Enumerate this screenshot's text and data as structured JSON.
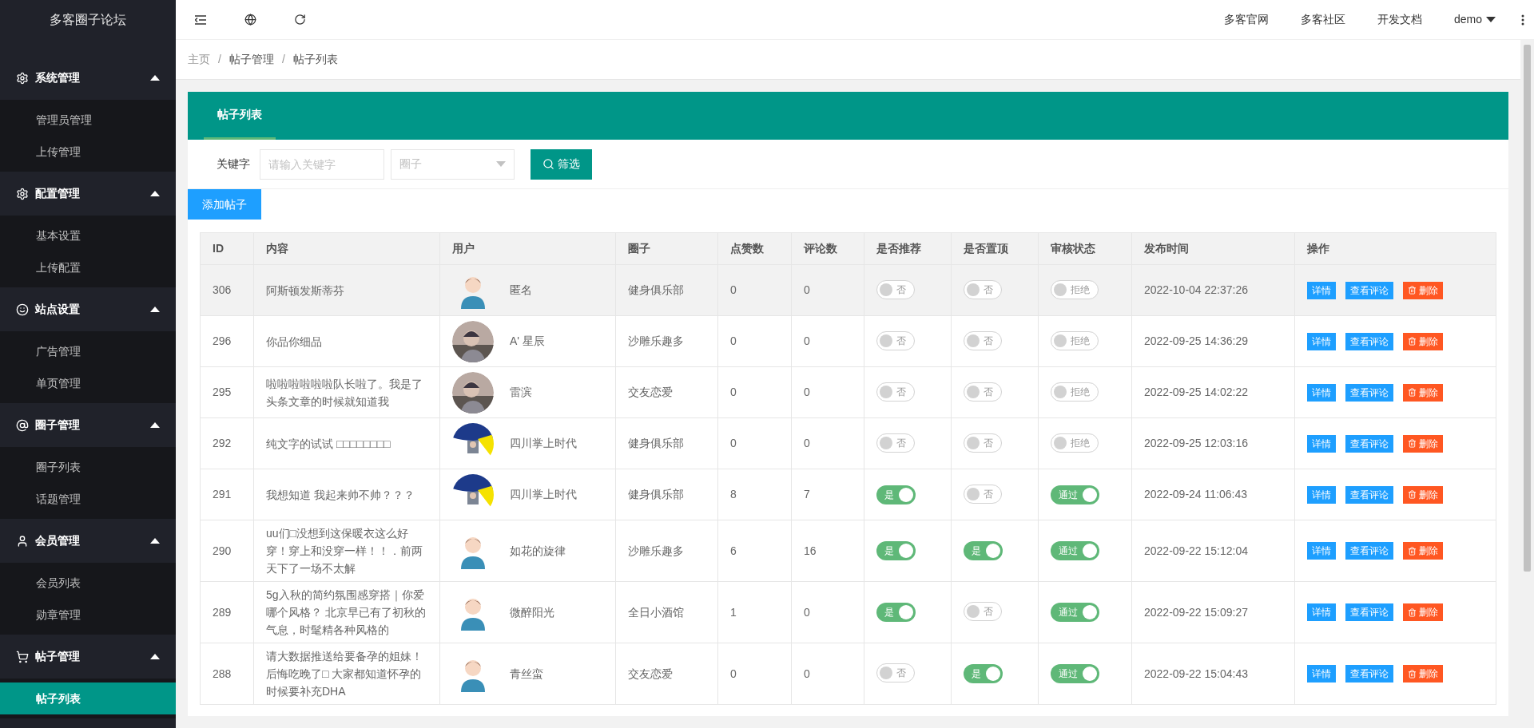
{
  "sidebar": {
    "title": "多客圈子论坛",
    "groups": [
      {
        "label": "系统管理",
        "expanded": true,
        "items": [
          {
            "label": "管理员管理",
            "selected": false
          },
          {
            "label": "上传管理",
            "selected": false
          }
        ]
      },
      {
        "label": "配置管理",
        "expanded": true,
        "items": [
          {
            "label": "基本设置",
            "selected": false
          },
          {
            "label": "上传配置",
            "selected": false
          }
        ]
      },
      {
        "label": "站点设置",
        "expanded": true,
        "items": [
          {
            "label": "广告管理",
            "selected": false
          },
          {
            "label": "单页管理",
            "selected": false
          }
        ]
      },
      {
        "label": "圈子管理",
        "expanded": true,
        "items": [
          {
            "label": "圈子列表",
            "selected": false
          },
          {
            "label": "话题管理",
            "selected": false
          }
        ]
      },
      {
        "label": "会员管理",
        "expanded": true,
        "items": [
          {
            "label": "会员列表",
            "selected": false
          },
          {
            "label": "勋章管理",
            "selected": false
          }
        ]
      },
      {
        "label": "帖子管理",
        "expanded": true,
        "items": [
          {
            "label": "帖子列表",
            "selected": true
          }
        ]
      }
    ]
  },
  "topbar": {
    "links": [
      "多客官网",
      "多客社区",
      "开发文档"
    ],
    "user": "demo"
  },
  "breadcrumb": {
    "separator": "/",
    "items": [
      "主页",
      "帖子管理",
      "帖子列表"
    ]
  },
  "card": {
    "tab": "帖子列表"
  },
  "filter": {
    "label": "关键字",
    "keyword_placeholder": "请输入关键字",
    "circle_placeholder": "圈子",
    "button": "筛选"
  },
  "add_button": "添加帖子",
  "table": {
    "columns": [
      "ID",
      "内容",
      "用户",
      "圈子",
      "点赞数",
      "评论数",
      "是否推荐",
      "是否置顶",
      "审核状态",
      "发布时间",
      "操作"
    ],
    "rows": [
      {
        "highlighted": true,
        "id": "306",
        "content": "阿斯顿发斯蒂芬",
        "avatar": {
          "kind": "default"
        },
        "user": "匿名",
        "circle": "健身俱乐部",
        "likes": "0",
        "comments": "0",
        "recommend": {
          "on": false,
          "label": "否"
        },
        "pinned": {
          "on": false,
          "label": "否"
        },
        "audit": {
          "on": false,
          "label": "拒绝"
        },
        "time": "2022-10-04 22:37:26",
        "actions": [
          "详情",
          "查看评论",
          "删除"
        ]
      },
      {
        "highlighted": false,
        "id": "296",
        "content": "你品你细品",
        "user": "A' 星辰",
        "circle": "沙雕乐趣多",
        "likes": "0",
        "comments": "0",
        "recommend": {
          "on": false,
          "label": "否"
        },
        "pinned": {
          "on": false,
          "label": "否"
        },
        "audit": {
          "on": false,
          "label": "拒绝"
        },
        "time": "2022-09-25 14:36:29",
        "actions": [
          "详情",
          "查看评论",
          "删除"
        ]
      },
      {
        "highlighted": false,
        "id": "295",
        "content": "啦啦啦啦啦啦队长啦了。我是了头条文章的时候就知道我",
        "user": "雷滨",
        "circle": "交友恋爱",
        "likes": "0",
        "comments": "0",
        "recommend": {
          "on": false,
          "label": "否"
        },
        "pinned": {
          "on": false,
          "label": "否"
        },
        "audit": {
          "on": false,
          "label": "拒绝"
        },
        "time": "2022-09-25 14:02:22",
        "actions": [
          "详情",
          "查看评论",
          "删除"
        ]
      },
      {
        "highlighted": false,
        "id": "292",
        "content": "纯文字的试试 □□□□□□□□",
        "user": "四川掌上时代",
        "circle": "健身俱乐部",
        "likes": "0",
        "comments": "0",
        "recommend": {
          "on": false,
          "label": "否"
        },
        "pinned": {
          "on": false,
          "label": "否"
        },
        "audit": {
          "on": false,
          "label": "拒绝"
        },
        "time": "2022-09-25 12:03:16",
        "actions": [
          "详情",
          "查看评论",
          "删除"
        ]
      },
      {
        "highlighted": false,
        "id": "291",
        "content": "我想知道 我起来帅不帅？？？",
        "user": "四川掌上时代",
        "circle": "健身俱乐部",
        "likes": "8",
        "comments": "7",
        "recommend": {
          "on": true,
          "label": "是"
        },
        "pinned": {
          "on": false,
          "label": "否"
        },
        "audit": {
          "on": true,
          "label": "通过"
        },
        "time": "2022-09-24 11:06:43",
        "actions": [
          "详情",
          "查看评论",
          "删除"
        ]
      },
      {
        "highlighted": false,
        "id": "290",
        "content": "uu们□没想到这保暖衣这么好穿！穿上和没穿一样！！．前两天下了一场不太解",
        "avatar": {
          "kind": "default"
        },
        "user": "如花的旋律",
        "circle": "沙雕乐趣多",
        "likes": "6",
        "comments": "16",
        "recommend": {
          "on": true,
          "label": "是"
        },
        "pinned": {
          "on": true,
          "label": "是"
        },
        "audit": {
          "on": true,
          "label": "通过"
        },
        "time": "2022-09-22 15:12:04",
        "actions": [
          "详情",
          "查看评论",
          "删除"
        ]
      },
      {
        "highlighted": false,
        "id": "289",
        "content": "5g入秋的简约氛围感穿搭｜你爱哪个风格？ 北京早已有了初秋的气息，时髦精各种风格的",
        "avatar": {
          "kind": "default"
        },
        "user": "微醉阳光",
        "circle": "全日小酒馆",
        "likes": "1",
        "comments": "0",
        "recommend": {
          "on": true,
          "label": "是"
        },
        "pinned": {
          "on": false,
          "label": "否"
        },
        "audit": {
          "on": true,
          "label": "通过"
        },
        "time": "2022-09-22 15:09:27",
        "actions": [
          "详情",
          "查看评论",
          "删除"
        ]
      },
      {
        "highlighted": false,
        "id": "288",
        "content": "请大数据推送给要备孕的姐妹！后悔吃晚了□ 大家都知道怀孕的时候要补充DHA",
        "avatar": {
          "kind": "default"
        },
        "user": "青丝蛮",
        "circle": "交友恋爱",
        "likes": "0",
        "comments": "0",
        "recommend": {
          "on": false,
          "label": "否"
        },
        "pinned": {
          "on": true,
          "label": "是"
        },
        "audit": {
          "on": true,
          "label": "通过"
        },
        "time": "2022-09-22 15:04:43",
        "actions": [
          "详情",
          "查看评论",
          "删除"
        ]
      }
    ]
  }
}
